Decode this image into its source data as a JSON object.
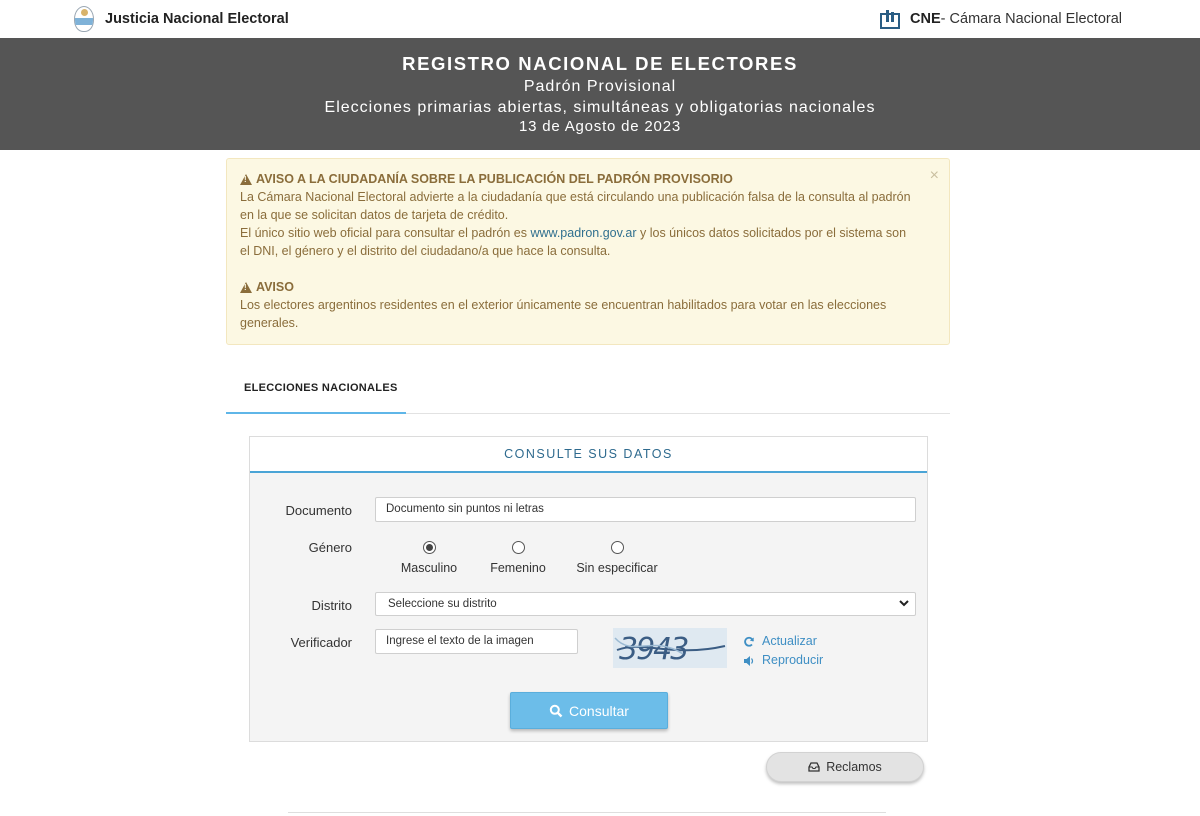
{
  "header": {
    "left_title": "Justicia Nacional Electoral",
    "right_abbr": "CNE",
    "right_title": " - Cámara Nacional Electoral"
  },
  "banner": {
    "title": "REGISTRO NACIONAL DE ELECTORES",
    "subtitle": "Padrón Provisional",
    "election": "Elecciones primarias abiertas, simultáneas y obligatorias nacionales",
    "date": "13 de Agosto de 2023"
  },
  "alert": {
    "close": "×",
    "heading1": "AVISO A LA CIUDADANÍA SOBRE LA PUBLICACIÓN DEL PADRÓN PROVISORIO",
    "p1_line1": "La Cámara Nacional Electoral advierte a la ciudadanía que está circulando una publicación falsa de la consulta al padrón",
    "p1_line2": "en la que se solicitan datos de tarjeta de crédito.",
    "p2_before": "El único sitio web oficial para consultar el padrón es ",
    "p2_link": "www.padron.gov.ar",
    "p2_after": " y los únicos datos solicitados por el sistema son",
    "p2_line2": "el DNI, el género y el distrito del ciudadano/a que hace la consulta.",
    "heading2": "AVISO",
    "p3_line1": "Los electores argentinos residentes en el exterior únicamente se encuentran habilitados para votar en las elecciones",
    "p3_line2": "generales."
  },
  "tabs": [
    {
      "label": "ELECCIONES NACIONALES",
      "active": true
    }
  ],
  "form": {
    "title": "CONSULTE SUS DATOS",
    "documento_label": "Documento",
    "documento_placeholder": "Documento sin puntos ni letras",
    "genero_label": "Género",
    "genero_options": [
      {
        "label": "Masculino",
        "selected": true
      },
      {
        "label": "Femenino",
        "selected": false
      },
      {
        "label": "Sin especificar",
        "selected": false
      }
    ],
    "distrito_label": "Distrito",
    "distrito_selected": "Seleccione su distrito",
    "verificador_label": "Verificador",
    "verificador_placeholder": "Ingrese el texto de la imagen",
    "captcha_text": "3943",
    "actualizar": "Actualizar",
    "reproducir": "Reproducir",
    "submit": "Consultar"
  },
  "reclamos": "Reclamos",
  "colors": {
    "banner_bg": "#555555",
    "alert_bg": "#fcf8e3",
    "alert_text": "#8a6d3b",
    "accent": "#4aa4d6",
    "button": "#6cbde9",
    "link": "#3f8fc4"
  },
  "icons": [
    "argentina-seal-icon",
    "cne-logo-icon",
    "warning-icon",
    "refresh-icon",
    "speaker-icon",
    "search-icon",
    "inbox-icon",
    "chevron-down-icon"
  ]
}
